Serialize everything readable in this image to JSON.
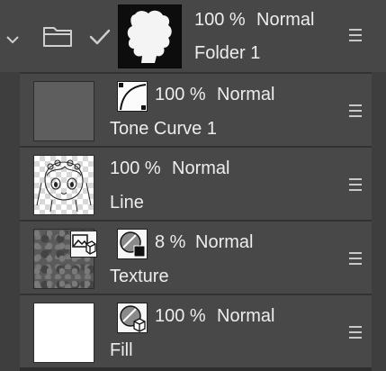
{
  "layers": [
    {
      "id": "folder",
      "opacity": "100 %",
      "blend": "Normal",
      "name": "Folder 1"
    },
    {
      "id": "tone",
      "opacity": "100 %",
      "blend": "Normal",
      "name": "Tone Curve 1"
    },
    {
      "id": "line",
      "opacity": "100 %",
      "blend": "Normal",
      "name": "Line"
    },
    {
      "id": "texture",
      "opacity": "8 %",
      "blend": "Normal",
      "name": "Texture"
    },
    {
      "id": "fill",
      "opacity": "100 %",
      "blend": "Normal",
      "name": "Fill"
    }
  ],
  "icons": {
    "collapse": "chevron-down-icon",
    "folder": "folder-icon",
    "check": "checkmark-icon",
    "menu": "layer-menu-icon",
    "tone_curve": "tone-curve-icon",
    "material": "material-icon"
  },
  "colors": {
    "panel": "#3a3a3a",
    "row": "#484848",
    "text": "#ededed"
  }
}
